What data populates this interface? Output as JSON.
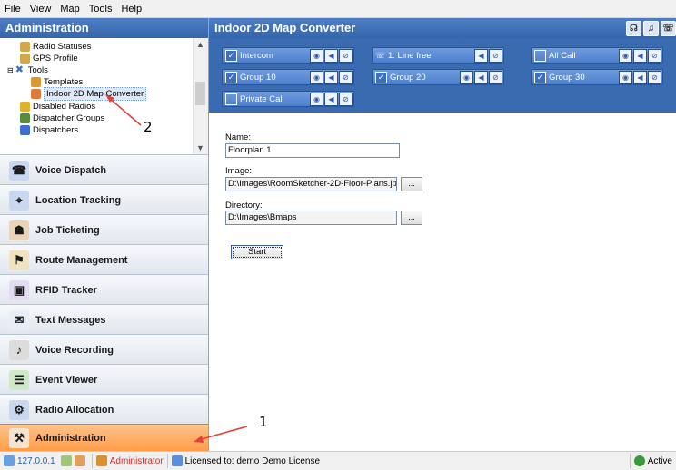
{
  "menu": [
    "File",
    "View",
    "Map",
    "Tools",
    "Help"
  ],
  "left_title": "Administration",
  "tree": [
    {
      "label": "Radio Statuses",
      "color": "#d6a74a"
    },
    {
      "label": "GPS Profile",
      "color": "#d6a74a"
    },
    {
      "label": "Tools",
      "color": "#3a6fd0"
    },
    {
      "label": "Templates",
      "color": "#d99a2e"
    },
    {
      "label": "Indoor 2D Map Converter",
      "color": "#e07a3c"
    },
    {
      "label": "Disabled Radios",
      "color": "#e0b030"
    },
    {
      "label": "Dispatcher Groups",
      "color": "#5b8a3c"
    },
    {
      "label": "Dispatchers",
      "color": "#3a6fd0"
    }
  ],
  "nav": [
    {
      "label": "Voice Dispatch",
      "icon": "voice-dispatch-icon"
    },
    {
      "label": "Location Tracking",
      "icon": "location-tracking-icon"
    },
    {
      "label": "Job Ticketing",
      "icon": "job-ticketing-icon"
    },
    {
      "label": "Route Management",
      "icon": "route-management-icon"
    },
    {
      "label": "RFID Tracker",
      "icon": "rfid-tracker-icon"
    },
    {
      "label": "Text Messages",
      "icon": "text-messages-icon"
    },
    {
      "label": "Voice Recording",
      "icon": "voice-recording-icon"
    },
    {
      "label": "Event Viewer",
      "icon": "event-viewer-icon"
    },
    {
      "label": "Radio Allocation",
      "icon": "radio-allocation-icon"
    },
    {
      "label": "Administration",
      "icon": "administration-icon"
    }
  ],
  "right_title": "Indoor 2D Map Converter",
  "groups": [
    {
      "label": "Intercom",
      "checked": true
    },
    {
      "label": "1: Line free",
      "checked": false
    },
    {
      "label": "All Call",
      "checked": false
    },
    {
      "label": "Group 10",
      "checked": true
    },
    {
      "label": "Group 20",
      "checked": true
    },
    {
      "label": "Group 30",
      "checked": true
    },
    {
      "label": "Private Call",
      "checked": false
    }
  ],
  "form": {
    "name_label": "Name:",
    "name_value": "Floorplan 1",
    "image_label": "Image:",
    "image_value": "D:\\Images\\RoomSketcher-2D-Floor-Plans.jpg",
    "dir_label": "Directory:",
    "dir_value": "D:\\Images\\Bmaps",
    "browse": "...",
    "start": "Start"
  },
  "annotations": {
    "one": "1",
    "two": "2"
  },
  "status": {
    "ip": "127.0.0.1",
    "user": "Administrator",
    "license": "Licensed to: demo Demo License",
    "state": "Active"
  },
  "colors": {
    "accent": "#3565ab",
    "active_nav": "#ff9c45",
    "annotation_arrow": "#e0403a"
  }
}
